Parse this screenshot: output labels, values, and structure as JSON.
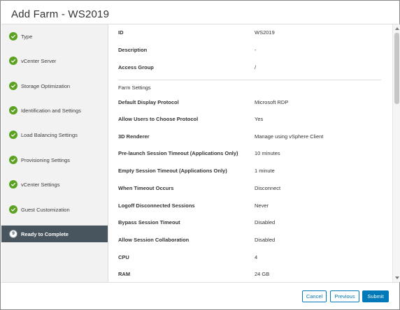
{
  "dialog": {
    "title": "Add Farm - WS2019"
  },
  "steps": [
    {
      "label": "Type",
      "status": "complete"
    },
    {
      "label": "vCenter Server",
      "status": "complete"
    },
    {
      "label": "Storage Optimization",
      "status": "complete"
    },
    {
      "label": "Identification and Settings",
      "status": "complete"
    },
    {
      "label": "Load Balancing Settings",
      "status": "complete"
    },
    {
      "label": "Provisioning Settings",
      "status": "complete"
    },
    {
      "label": "vCenter Settings",
      "status": "complete"
    },
    {
      "label": "Guest Customization",
      "status": "complete"
    },
    {
      "label": "Ready to Complete",
      "status": "active",
      "number": "9"
    }
  ],
  "summary": {
    "top": [
      {
        "key": "ID",
        "value": "WS2019"
      },
      {
        "key": "Description",
        "value": "-"
      },
      {
        "key": "Access Group",
        "value": "/"
      }
    ],
    "section_title": "Farm Settings",
    "farm": [
      {
        "key": "Default Display Protocol",
        "value": "Microsoft RDP"
      },
      {
        "key": "Allow Users to Choose Protocol",
        "value": "Yes"
      },
      {
        "key": "3D Renderer",
        "value": "Manage using vSphere Client"
      },
      {
        "key": "Pre-launch Session Timeout (Applications Only)",
        "value": "10 minutes"
      },
      {
        "key": "Empty Session Timeout (Applications Only)",
        "value": "1 minute"
      },
      {
        "key": "When Timeout Occurs",
        "value": "Disconnect"
      },
      {
        "key": "Logoff Disconnected Sessions",
        "value": "Never"
      },
      {
        "key": "Bypass Session Timeout",
        "value": "Disabled"
      },
      {
        "key": "Allow Session Collaboration",
        "value": "Disabled"
      },
      {
        "key": "CPU",
        "value": "4"
      },
      {
        "key": "RAM",
        "value": "24 GB"
      }
    ]
  },
  "buttons": {
    "cancel": "Cancel",
    "previous": "Previous",
    "submit": "Submit"
  },
  "colors": {
    "complete": "#5aa220",
    "active_step_bg": "#48545e",
    "primary": "#0079b8"
  }
}
